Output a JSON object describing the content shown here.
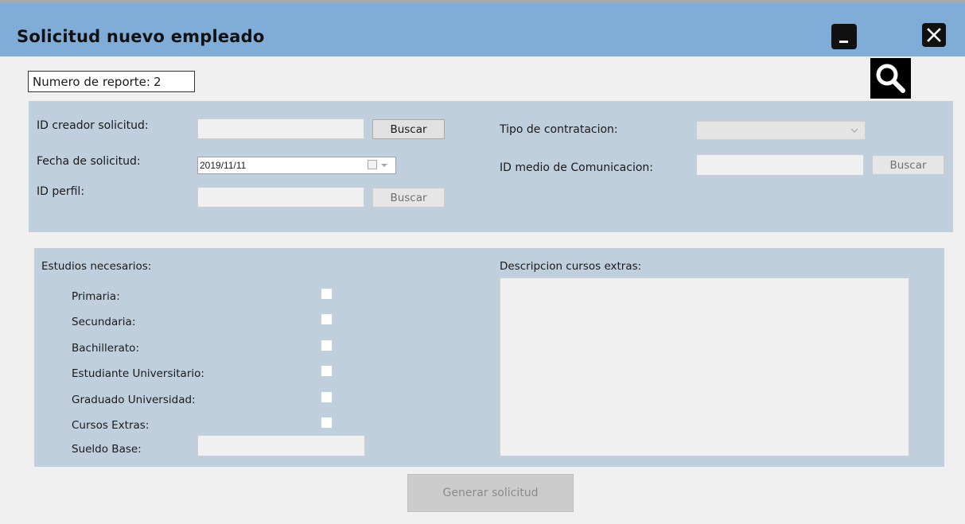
{
  "window": {
    "title": "Solicitud nuevo empleado",
    "minimize_icon": "minimize-icon",
    "close_icon": "close-icon",
    "search_icon": "search-icon"
  },
  "report": {
    "label": "Numero de reporte:",
    "value": "2"
  },
  "top_form": {
    "id_creador_label": "ID creador solicitud:",
    "id_creador_value": "",
    "buscar_creador_label": "Buscar",
    "fecha_label": "Fecha de solicitud:",
    "fecha_value": "2019/11/11",
    "id_perfil_label": "ID perfil:",
    "id_perfil_value": "",
    "buscar_perfil_label": "Buscar",
    "tipo_label": "Tipo de contratacion:",
    "tipo_value": "",
    "medio_label": "ID medio de Comunicacion:",
    "medio_value": "",
    "buscar_medio_label": "Buscar"
  },
  "studies": {
    "heading": "Estudios necesarios:",
    "items": [
      {
        "label": "Primaria:",
        "checked": false
      },
      {
        "label": "Secundaria:",
        "checked": false
      },
      {
        "label": "Bachillerato:",
        "checked": false
      },
      {
        "label": "Estudiante Universitario:",
        "checked": false
      },
      {
        "label": "Graduado Universidad:",
        "checked": false
      },
      {
        "label": "Cursos Extras:",
        "checked": false
      }
    ],
    "sueldo_label": "Sueldo Base:",
    "sueldo_value": ""
  },
  "extras": {
    "heading": "Descripcion cursos extras:",
    "value": ""
  },
  "actions": {
    "generate_label": "Generar solicitud"
  },
  "colors": {
    "titlebar": "#7fadd8",
    "panel": "#c0cfdd",
    "window_bg": "#f0f0f0"
  }
}
